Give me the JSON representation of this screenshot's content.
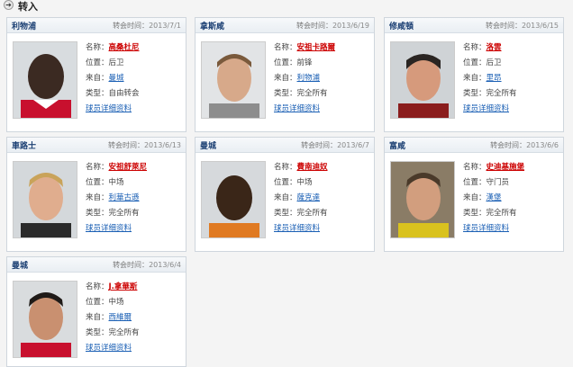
{
  "header": {
    "icon": "arrow-right-circle-icon",
    "title": "转入"
  },
  "labels": {
    "date_prefix": "转会时间：",
    "name": "名称：",
    "position": "位置：",
    "from": "来自：",
    "type": "类型：",
    "details_link": "球员详细资料"
  },
  "transfers": [
    {
      "club": "利物浦",
      "date": "2013/7/1",
      "name": "高桑杜尼",
      "position": "后卫",
      "from": "曼城",
      "type": "自由转会"
    },
    {
      "club": "拿斯咸",
      "date": "2013/6/19",
      "name": "安祖卡路爾",
      "position": "前锋",
      "from": "利物浦",
      "type": "完全所有"
    },
    {
      "club": "修咸頓",
      "date": "2013/6/15",
      "name": "洛雲",
      "position": "后卫",
      "from": "里昂",
      "type": "完全所有"
    },
    {
      "club": "車路士",
      "date": "2013/6/13",
      "name": "安祖舒萊尼",
      "position": "中场",
      "from": "利華古遜",
      "type": "完全所有"
    },
    {
      "club": "曼城",
      "date": "2013/6/7",
      "name": "費南迪奴",
      "position": "中场",
      "from": "薩克達",
      "type": "完全所有"
    },
    {
      "club": "富咸",
      "date": "2013/6/6",
      "name": "史迪基施堡",
      "position": "守门员",
      "from": "漢堡",
      "type": "完全所有"
    },
    {
      "club": "曼城",
      "date": "2013/6/4",
      "name": "J.拿華斯",
      "position": "中场",
      "from": "西維爾",
      "type": "完全所有"
    }
  ]
}
